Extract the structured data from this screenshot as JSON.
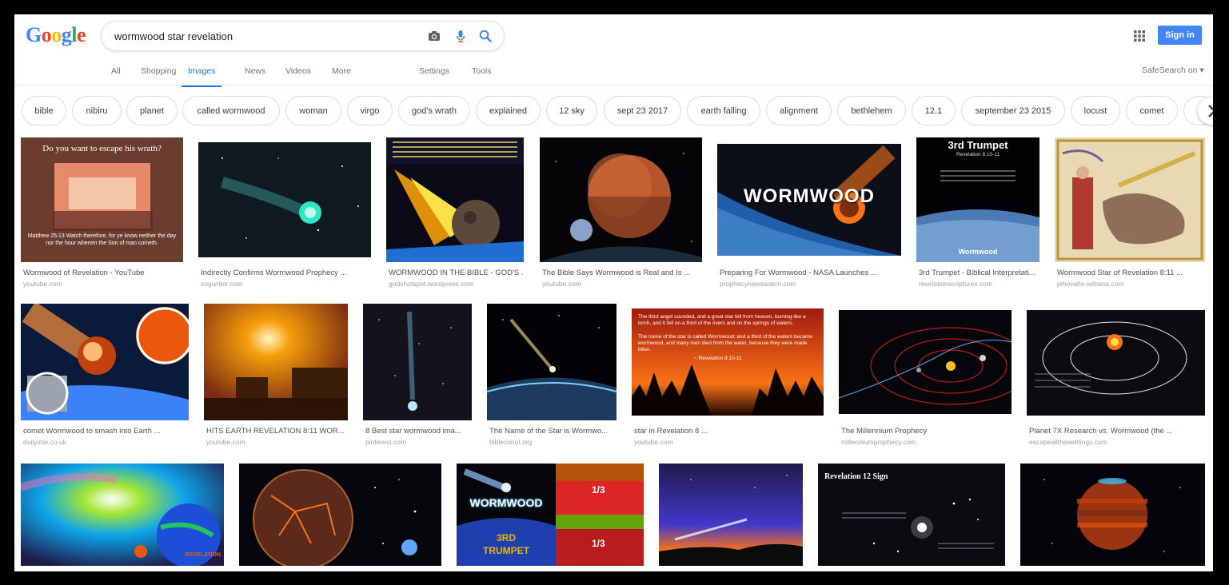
{
  "logo": {
    "text": "Google",
    "letters": [
      "G",
      "o",
      "o",
      "g",
      "l",
      "e"
    ]
  },
  "search": {
    "query": "wormwood star revelation"
  },
  "header": {
    "signin_label": "Sign in"
  },
  "nav": {
    "tabs": [
      "All",
      "Shopping",
      "Images",
      "News",
      "Videos",
      "More"
    ],
    "active": "Images",
    "settings": "Settings",
    "tools": "Tools",
    "safesearch": "SafeSearch on ▾"
  },
  "chips": [
    "bible",
    "nibiru",
    "planet",
    "called wormwood",
    "woman",
    "virgo",
    "god's wrath",
    "explained",
    "12 sky",
    "sept 23 2017",
    "earth falling",
    "alignment",
    "bethlehem",
    "12.1",
    "september 23 2015",
    "locust",
    "comet"
  ],
  "results": {
    "row1": [
      {
        "title": "Wormwood of Revelation - YouTube",
        "domain": "youtube.com",
        "overlay_text": "Do you want to escape his wrath?",
        "caption_text": "Matthew 25:13 Watch therefore, for ye know neither the day nor the hour wherein the Son of man cometh."
      },
      {
        "title": "Indirectly Confirms Wormwood Prophecy ...",
        "domain": "cogwriter.com"
      },
      {
        "title": "WORMWOOD IN THE BIBLE - GOD'S ...",
        "domain": "godshotspot.wordpress.com"
      },
      {
        "title": "The Bible Says Wormwood is Real and Is ...",
        "domain": "youtube.com"
      },
      {
        "title": "Preparing For Wormwood - NASA Launches ...",
        "domain": "prophecynewswatch.com",
        "overlay_text": "WORMWOOD"
      },
      {
        "title": "3rd Trumpet - Biblical Interpretati...",
        "domain": "revelationscriptures.com",
        "overlay_text": "3rd Trumpet",
        "overlay_sub": "Revelation 8:10-11",
        "caption_text": "Wormwood"
      },
      {
        "title": "Wormwood Star of Revelation 8:11 ...",
        "domain": "jehovahs-witness.com"
      }
    ],
    "row2": [
      {
        "title": "comet Wormwood to smash into Earth ...",
        "domain": "dailystar.co.uk"
      },
      {
        "title": "HITS EARTH REVELATION 8:11 WOR...",
        "domain": "youtube.com"
      },
      {
        "title": "8 Best star wormwood ima...",
        "domain": "pinterest.com"
      },
      {
        "title": "The Name of the Star is Wormwo...",
        "domain": "bibleconot.org"
      },
      {
        "title": "star in Revelation 8 ...",
        "domain": "youtube.com",
        "overlay_text": "The third angel sounded, and a great star fell from heaven, burning like a torch, and it fell on a third of the rivers and on the springs of waters.",
        "overlay_sub": "The name of the star is called Wormwood; and a third of the waters became wormwood, and many men died from the water, because they were made bitter.",
        "caption_text": "~ Revelation 8:10-11"
      },
      {
        "title": "The Millennium Prophecy",
        "domain": "millenniumprophecy.com"
      },
      {
        "title": "Planet 7X Research vs. Wormwood (the ...",
        "domain": "escapeallthesethings.com"
      }
    ],
    "row3": [
      {
        "caption_text": "REVELATION"
      },
      {},
      {
        "overlay_text": "WORMWOOD",
        "overlay_sub": "3RD",
        "caption_text": "TRUMPET",
        "tag_a": "1/3",
        "tag_b": "1/3"
      },
      {},
      {
        "overlay_text": "Revelation 12 Sign"
      },
      {}
    ]
  },
  "colors": {
    "accent": "#1a73e8",
    "signin": "#4285f4"
  }
}
